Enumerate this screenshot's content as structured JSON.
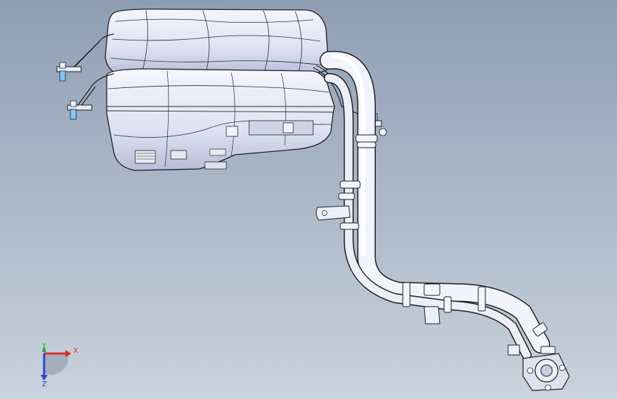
{
  "viewport": {
    "background_top": "#8f9eb3",
    "background_bottom": "#c9d2dd"
  },
  "triad": {
    "x_label": "X",
    "y_label": "Y",
    "z_label": "Z",
    "x_color": "#d42a2a",
    "y_color": "#2fae3a",
    "z_color": "#2a46c8"
  },
  "model": {
    "icon": "fuel-tank-assembly-model",
    "edge_color": "#1e1e24",
    "face_color": "#eef0fa",
    "shadow_color": "#b9bfd8"
  }
}
